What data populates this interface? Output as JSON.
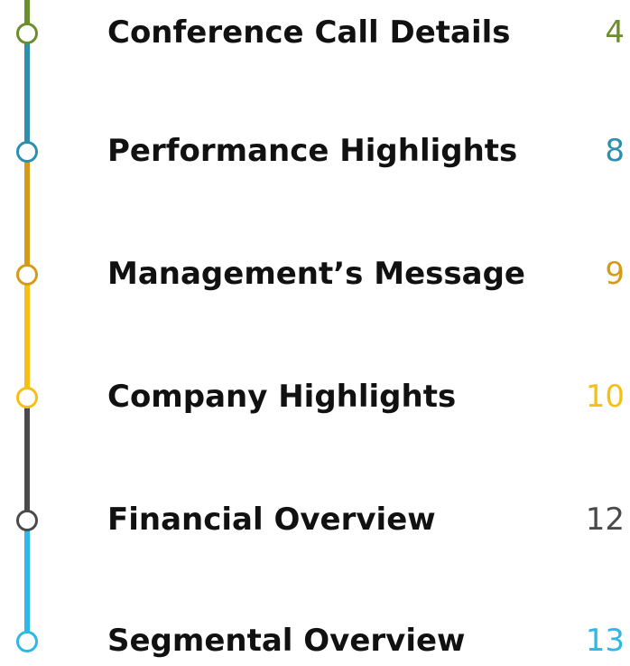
{
  "toc": {
    "entries": [
      {
        "title": "Conference Call Details",
        "page": "4",
        "color": "#6a8e2a"
      },
      {
        "title": "Performance Highlights",
        "page": "8",
        "color": "#2d8fab"
      },
      {
        "title": "Management’s Message",
        "page": "9",
        "color": "#d69b16"
      },
      {
        "title": "Company Highlights",
        "page": "10",
        "color": "#f5bf16"
      },
      {
        "title": "Financial Overview",
        "page": "12",
        "color": "#4a4a4a"
      },
      {
        "title": "Segmental Overview",
        "page": "13",
        "color": "#2db8e6"
      }
    ]
  }
}
